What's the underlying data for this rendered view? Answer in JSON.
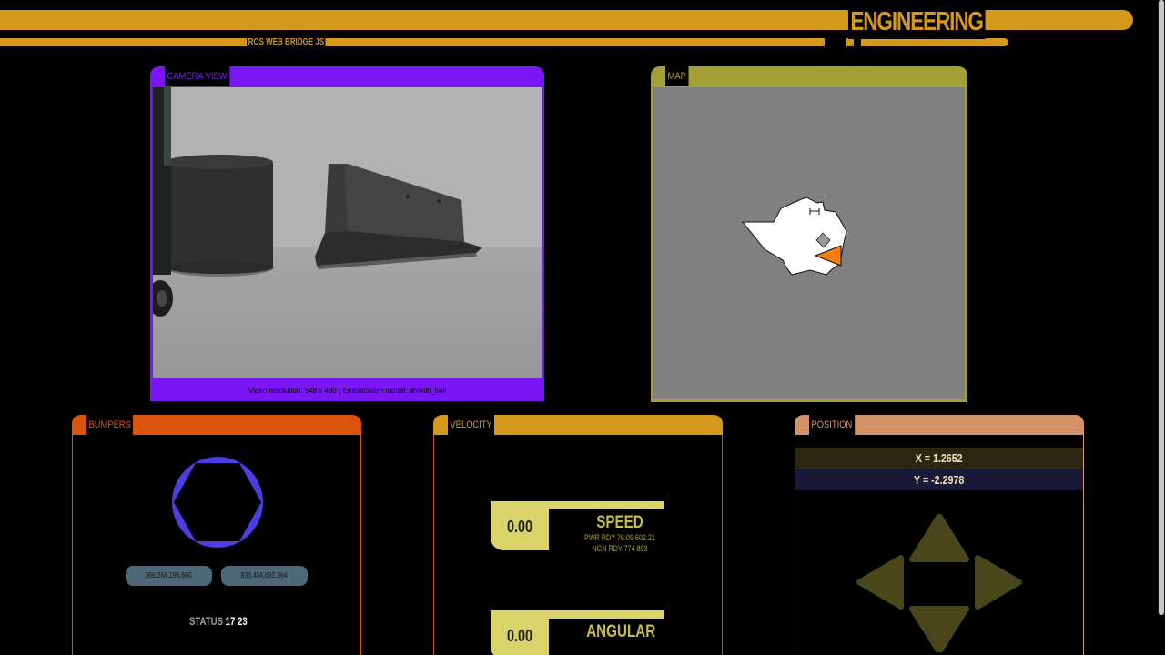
{
  "header": {
    "title": "ENGINEERING",
    "subtitle": "ROS WEB BRIDGE JS"
  },
  "camera": {
    "label": "CAMERA VIEW",
    "footer": "Video resolution: 648 x 480 | Embarcation model: ahoniti_bali"
  },
  "map": {
    "label": "MAP"
  },
  "bumpers": {
    "label": "BUMPERS",
    "left_value": "366,264,196,660",
    "right_value": "833,454,692,364",
    "status_label": "STATUS",
    "status_value": "17 23"
  },
  "velocity": {
    "label": "VELOCITY",
    "speed": {
      "value": "0.00",
      "title": "SPEED",
      "line1": "PWR RDY 76.09 602.21",
      "line2": "NGN RDY 774 893"
    },
    "angular": {
      "value": "0.00",
      "title": "ANGULAR"
    }
  },
  "position": {
    "label": "POSITION",
    "x": "X = 1.2652",
    "y": "Y = -2.2978"
  },
  "colors": {
    "header": "#d4991a",
    "camera": "#7b17f5",
    "map": "#a3a135",
    "bumpers": "#d9530a",
    "velocity": "#d4991a",
    "position": "#d39267",
    "robot_marker": "#f07e12",
    "dpad": "#49461a"
  }
}
